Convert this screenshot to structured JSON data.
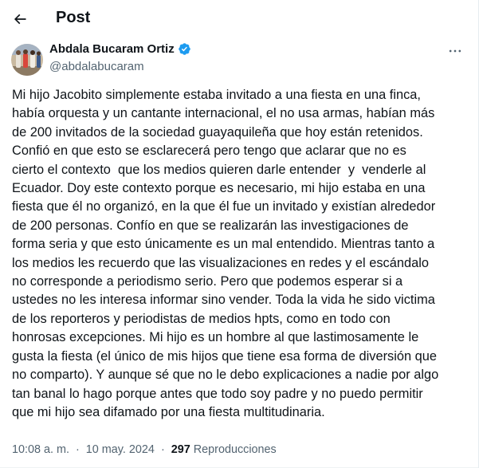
{
  "header": {
    "title": "Post"
  },
  "author": {
    "name": "Abdala Bucaram Ortiz",
    "handle": "@abdalabucaram"
  },
  "post": {
    "text": "Mi hijo Jacobito simplemente estaba invitado a una fiesta en una finca,\nhabía orquesta y un cantante internacional, el no usa armas, habían más\nde 200 invitados de la sociedad guayaquileña que hoy están retenidos.\nConfió en que esto se esclarecerá pero tengo que aclarar que no es\ncierto el contexto  que los medios quieren darle entender  y  venderle al\nEcuador. Doy este contexto porque es necesario, mi hijo estaba en una\nfiesta que él no organizó, en la que él fue un invitado y existían alrededor\nde 200 personas. Confío en que se realizarán las investigaciones de\nforma seria y que esto únicamente es un mal entendido. Mientras tanto a\nlos medios les recuerdo que las visualizaciones en redes y el escándalo\nno corresponde a periodismo serio. Pero que podemos esperar si a\nustedes no les interesa informar sino vender. Toda la vida he sido victima\nde los reporteros y periodistas de medios hpts, como en todo con\nhonrosas excepciones. Mi hijo es un hombre al que lastimosamente le\ngusta la fiesta (el único de mis hijos que tiene esa forma de diversión que\nno comparto). Y aunque sé que no le debo explicaciones a nadie por algo\ntan banal lo hago porque antes que todo soy padre y no puedo permitir\nque mi hijo sea difamado por una fiesta multitudinaria.",
    "time": "10:08 a. m.",
    "date": "10 may. 2024",
    "separator": "·",
    "views_count": "297",
    "views_label": "Reproducciones"
  },
  "icons": {
    "back": "back-arrow-icon",
    "verified": "verified-badge-icon",
    "more": "more-options-icon"
  },
  "colors": {
    "primary_text": "#0f1419",
    "secondary_text": "#536471",
    "verified_blue": "#1d9bf0",
    "background": "#ffffff"
  }
}
